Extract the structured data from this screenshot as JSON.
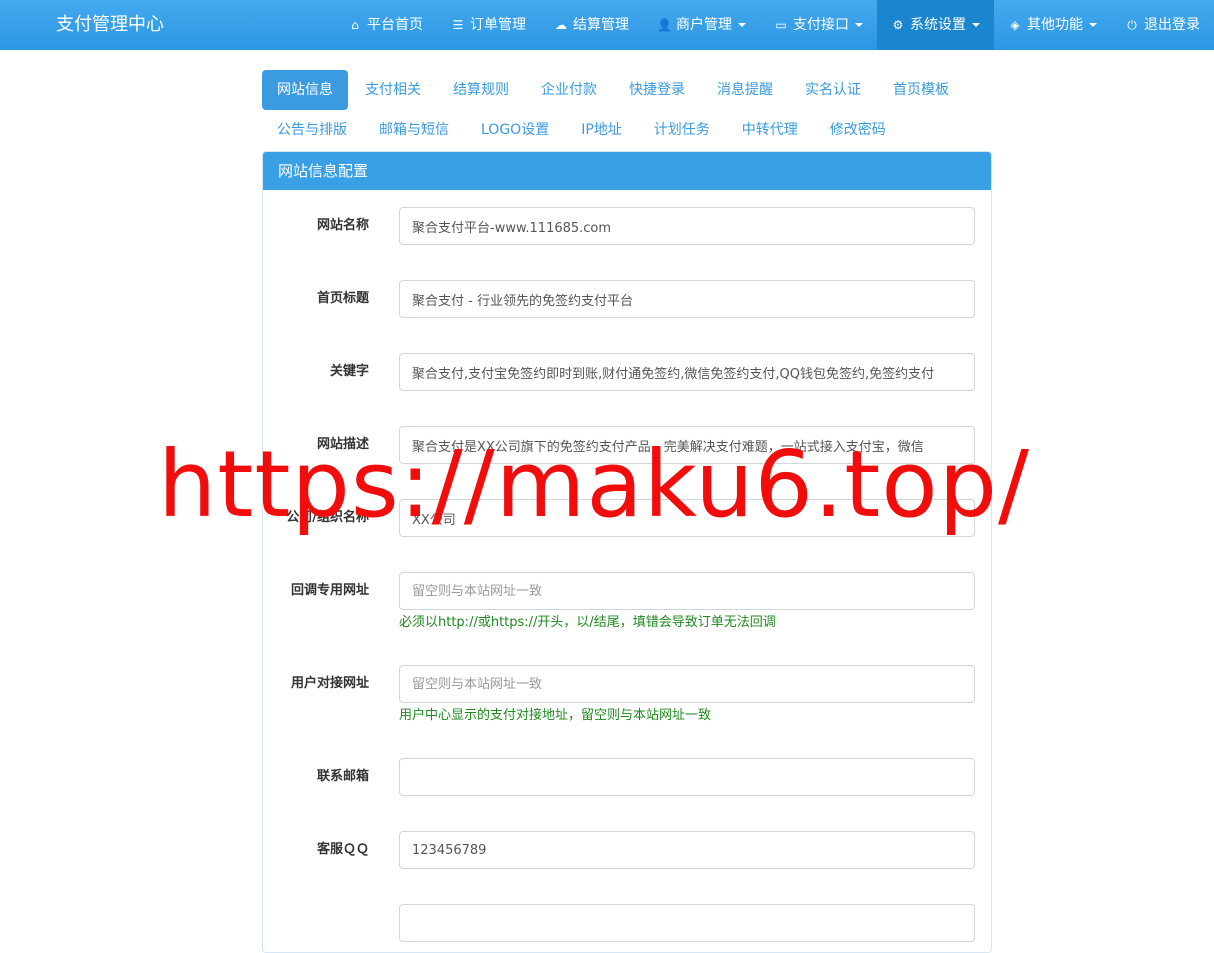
{
  "brand": "支付管理中心",
  "nav": [
    {
      "label": "平台首页",
      "icon": "home-icon",
      "glyph": "⌂",
      "dropdown": false
    },
    {
      "label": "订单管理",
      "icon": "list-icon",
      "glyph": "☰",
      "dropdown": false
    },
    {
      "label": "结算管理",
      "icon": "cloud-icon",
      "glyph": "☁",
      "dropdown": false
    },
    {
      "label": "商户管理",
      "icon": "user-icon",
      "glyph": "👤",
      "dropdown": true
    },
    {
      "label": "支付接口",
      "icon": "card-icon",
      "glyph": "▭",
      "dropdown": true
    },
    {
      "label": "系统设置",
      "icon": "gear-icon",
      "glyph": "⚙",
      "dropdown": true
    },
    {
      "label": "其他功能",
      "icon": "cube-icon",
      "glyph": "◈",
      "dropdown": true
    },
    {
      "label": "退出登录",
      "icon": "power-icon",
      "glyph": "⏻",
      "dropdown": false
    }
  ],
  "tabs": [
    "网站信息",
    "支付相关",
    "结算规则",
    "企业付款",
    "快捷登录",
    "消息提醒",
    "实名认证",
    "首页模板",
    "公告与排版",
    "邮箱与短信",
    "LOGO设置",
    "IP地址",
    "计划任务",
    "中转代理",
    "修改密码"
  ],
  "panel_title": "网站信息配置",
  "fields": {
    "site_name": {
      "label": "网站名称",
      "value": "聚合支付平台-www.111685.com"
    },
    "home_title": {
      "label": "首页标题",
      "value": "聚合支付 - 行业领先的免签约支付平台"
    },
    "keywords": {
      "label": "关键字",
      "value": "聚合支付,支付宝免签约即时到账,财付通免签约,微信免签约支付,QQ钱包免签约,免签约支付"
    },
    "description": {
      "label": "网站描述",
      "value": "聚合支付是XX公司旗下的免签约支付产品，完美解决支付难题，一站式接入支付宝，微信"
    },
    "company": {
      "label": "公司/组织名称",
      "value": "XX公司"
    },
    "callback_url": {
      "label": "回调专用网址",
      "placeholder": "留空则与本站网址一致",
      "help": "必须以http://或https://开头，以/结尾，填错会导致订单无法回调"
    },
    "user_url": {
      "label": "用户对接网址",
      "placeholder": "留空则与本站网址一致",
      "help": "用户中心显示的支付对接地址，留空则与本站网址一致"
    },
    "email": {
      "label": "联系邮箱",
      "value": ""
    },
    "qq": {
      "label": "客服ＱＱ",
      "value": "123456789"
    }
  },
  "watermark": "https://maku6.top/"
}
